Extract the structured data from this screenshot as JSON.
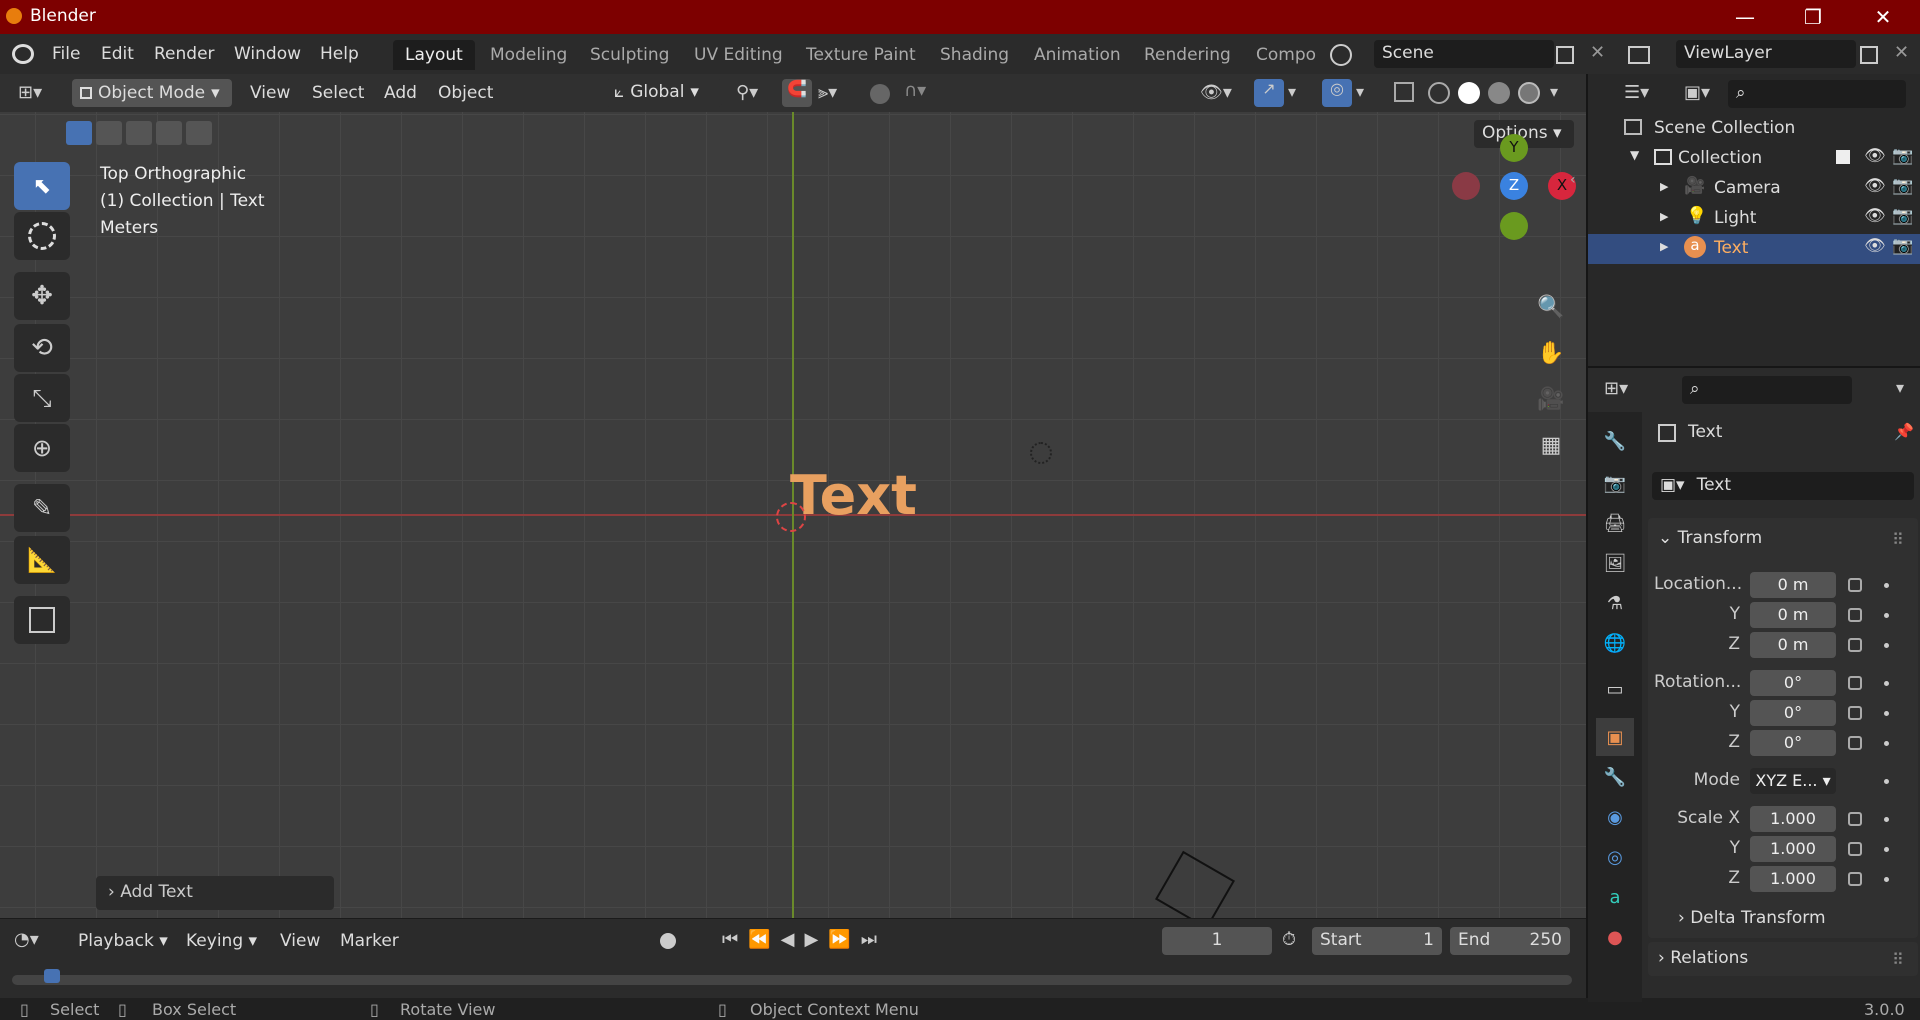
{
  "window": {
    "title": "Blender",
    "min": "—",
    "max": "❐",
    "close": "✕"
  },
  "menubar": {
    "items": [
      "File",
      "Edit",
      "Render",
      "Window",
      "Help"
    ],
    "tabs": [
      "Layout",
      "Modeling",
      "Sculpting",
      "UV Editing",
      "Texture Paint",
      "Shading",
      "Animation",
      "Rendering",
      "Compo"
    ],
    "scene": "Scene",
    "viewlayer": "ViewLayer"
  },
  "viewport_header": {
    "mode": "Object Mode",
    "menus": [
      "View",
      "Select",
      "Add",
      "Object"
    ],
    "orientation": "Global",
    "options": "Options"
  },
  "viewport": {
    "view_name": "Top Orthographic",
    "collection_info": "(1) Collection | Text",
    "units": "Meters",
    "object_text": "Text",
    "last_op": "Add Text",
    "gizmo": {
      "y": "Y",
      "z": "Z",
      "x": "X"
    }
  },
  "timeline": {
    "menus": [
      "Playback",
      "Keying",
      "View",
      "Marker"
    ],
    "current_frame": "1",
    "start_label": "Start",
    "start": "1",
    "end_label": "End",
    "end": "250"
  },
  "statusbar": {
    "select": "Select",
    "box_select": "Box Select",
    "rotate": "Rotate View",
    "context": "Object Context Menu",
    "version": "3.0.0"
  },
  "outliner": {
    "root": "Scene Collection",
    "collection": "Collection",
    "items": [
      "Camera",
      "Light",
      "Text"
    ]
  },
  "properties": {
    "object_name": "Text",
    "data_name": "Text",
    "section": "Transform",
    "location_label": "Location...",
    "rotation_label": "Rotation...",
    "mode_label": "Mode",
    "scale_label": "Scale X",
    "y": "Y",
    "z": "Z",
    "location": [
      "0 m",
      "0 m",
      "0 m"
    ],
    "rotation": [
      "0°",
      "0°",
      "0°"
    ],
    "mode": "XYZ E...",
    "scale": [
      "1.000",
      "1.000",
      "1.000"
    ],
    "delta": "Delta Transform",
    "relations": "Relations"
  },
  "colors": {
    "accent": "#4772b3",
    "title_bar": "#7d0000",
    "object_orange": "#e8a060",
    "x_axis": "#d7263d",
    "y_axis": "#6a9a1f",
    "z_axis": "#3a82e0"
  }
}
